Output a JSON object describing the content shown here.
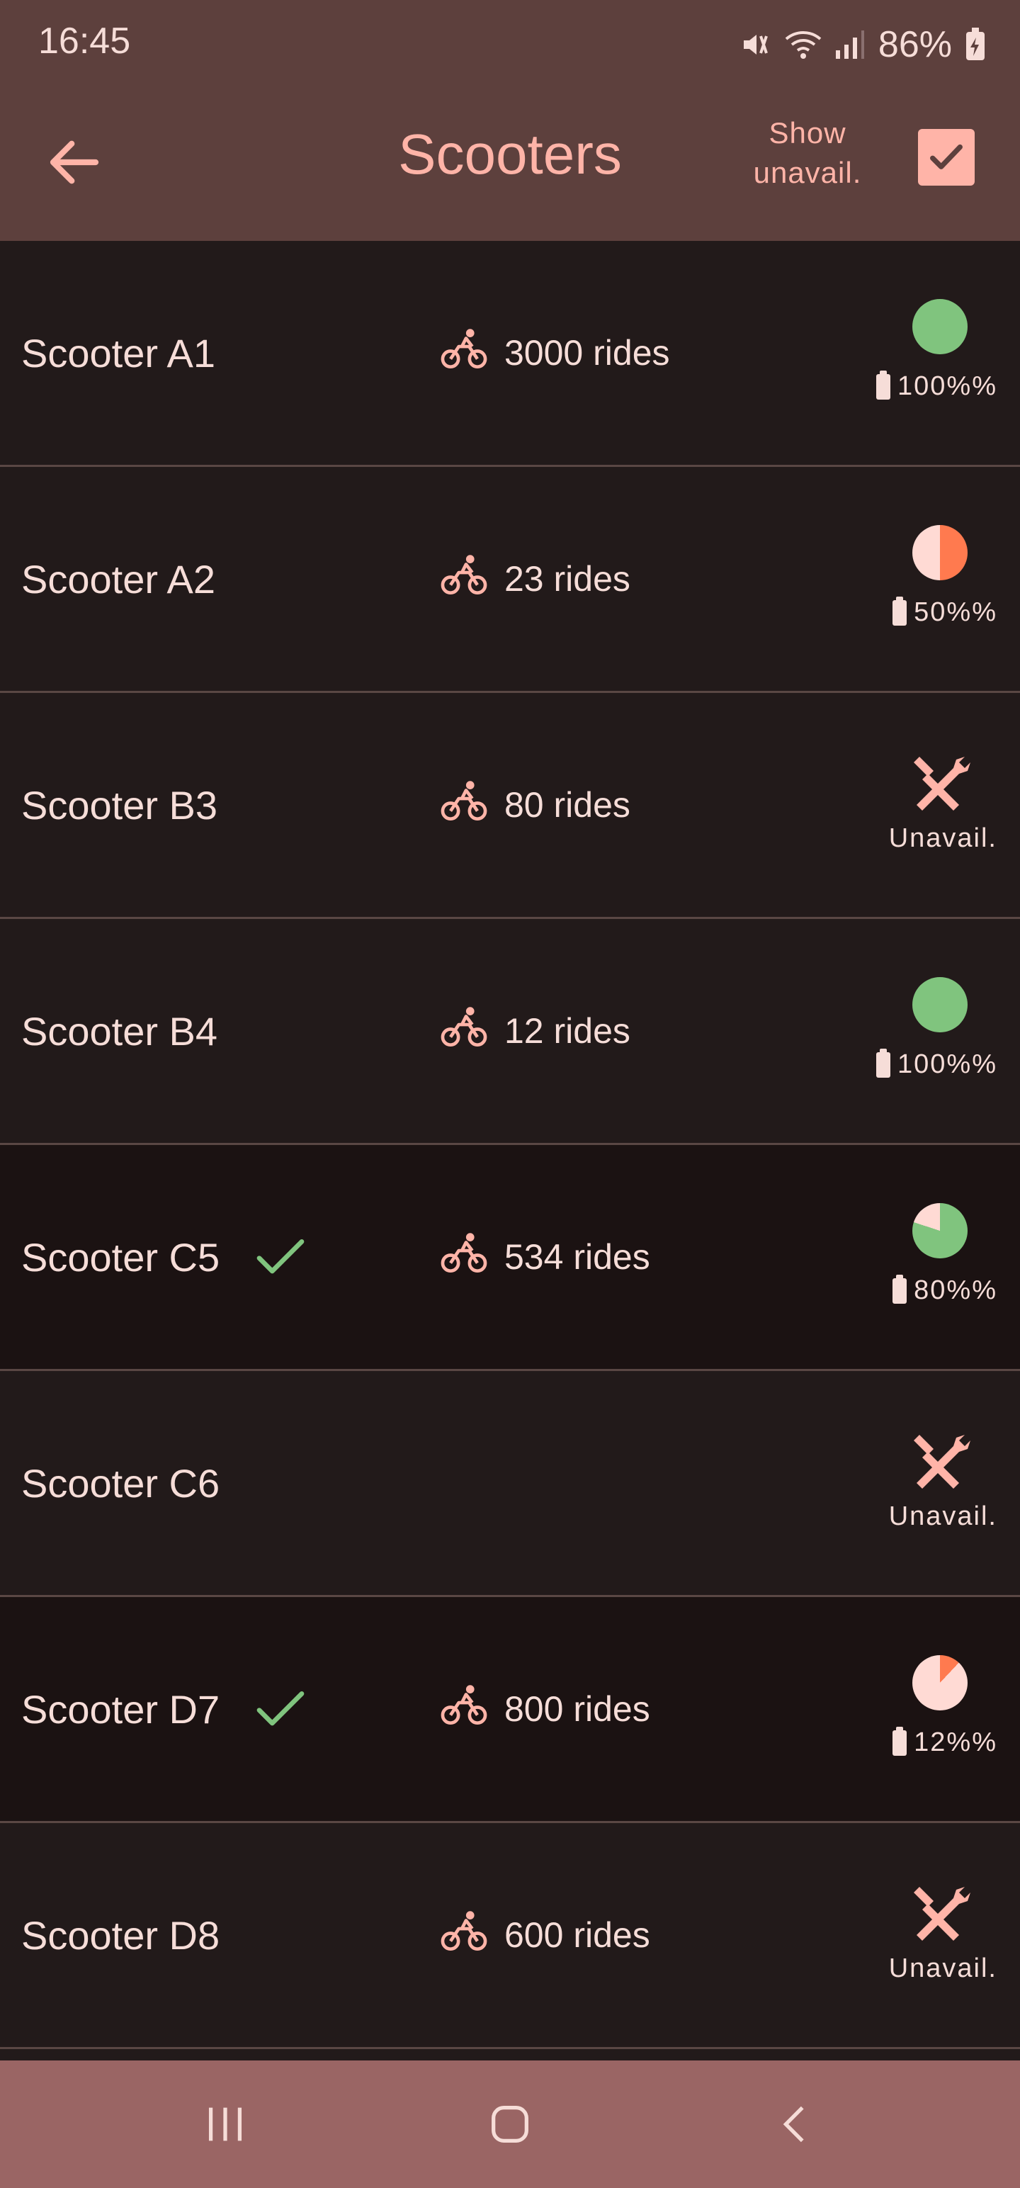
{
  "status_bar": {
    "time": "16:45",
    "battery_percent": "86%"
  },
  "app_bar": {
    "title": "Scooters",
    "show_unavailable_label": "Show\nunavail.",
    "show_unavailable_checked": true
  },
  "scooters": [
    {
      "name": "Scooter A1",
      "rides": "3000 rides",
      "status": "available",
      "battery_text": "100%%",
      "battery_fraction": 1.0,
      "pie_color": "#80c47e",
      "selected": false
    },
    {
      "name": "Scooter A2",
      "rides": "23 rides",
      "status": "available",
      "battery_text": "50%%",
      "battery_fraction": 0.5,
      "pie_color": "#ff7a4f",
      "selected": false
    },
    {
      "name": "Scooter B3",
      "rides": "80 rides",
      "status": "unavailable",
      "unavailable_text": "Unavail.",
      "selected": false
    },
    {
      "name": "Scooter B4",
      "rides": "12 rides",
      "status": "available",
      "battery_text": "100%%",
      "battery_fraction": 1.0,
      "pie_color": "#80c47e",
      "selected": false
    },
    {
      "name": "Scooter C5",
      "rides": "534 rides",
      "status": "available",
      "battery_text": "80%%",
      "battery_fraction": 0.8,
      "pie_color": "#80c47e",
      "selected": true
    },
    {
      "name": "Scooter C6",
      "rides": "",
      "status": "unavailable",
      "unavailable_text": "Unavail.",
      "selected": false
    },
    {
      "name": "Scooter D7",
      "rides": "800 rides",
      "status": "available",
      "battery_text": "12%%",
      "battery_fraction": 0.12,
      "pie_color": "#ff7a4f",
      "selected": true
    },
    {
      "name": "Scooter D8",
      "rides": "600 rides",
      "status": "unavailable",
      "unavailable_text": "Unavail.",
      "selected": false
    }
  ],
  "colors": {
    "accent": "#ffb4a8",
    "app_bar": "#5d403d",
    "nav_bar": "#9a6564",
    "check_green": "#80c47e",
    "pie_empty": "#ffdad4"
  },
  "icons": {
    "back": "arrow-back-icon",
    "rides": "bike-rider-icon",
    "unavailable": "tools-icon",
    "selected": "check-icon"
  }
}
